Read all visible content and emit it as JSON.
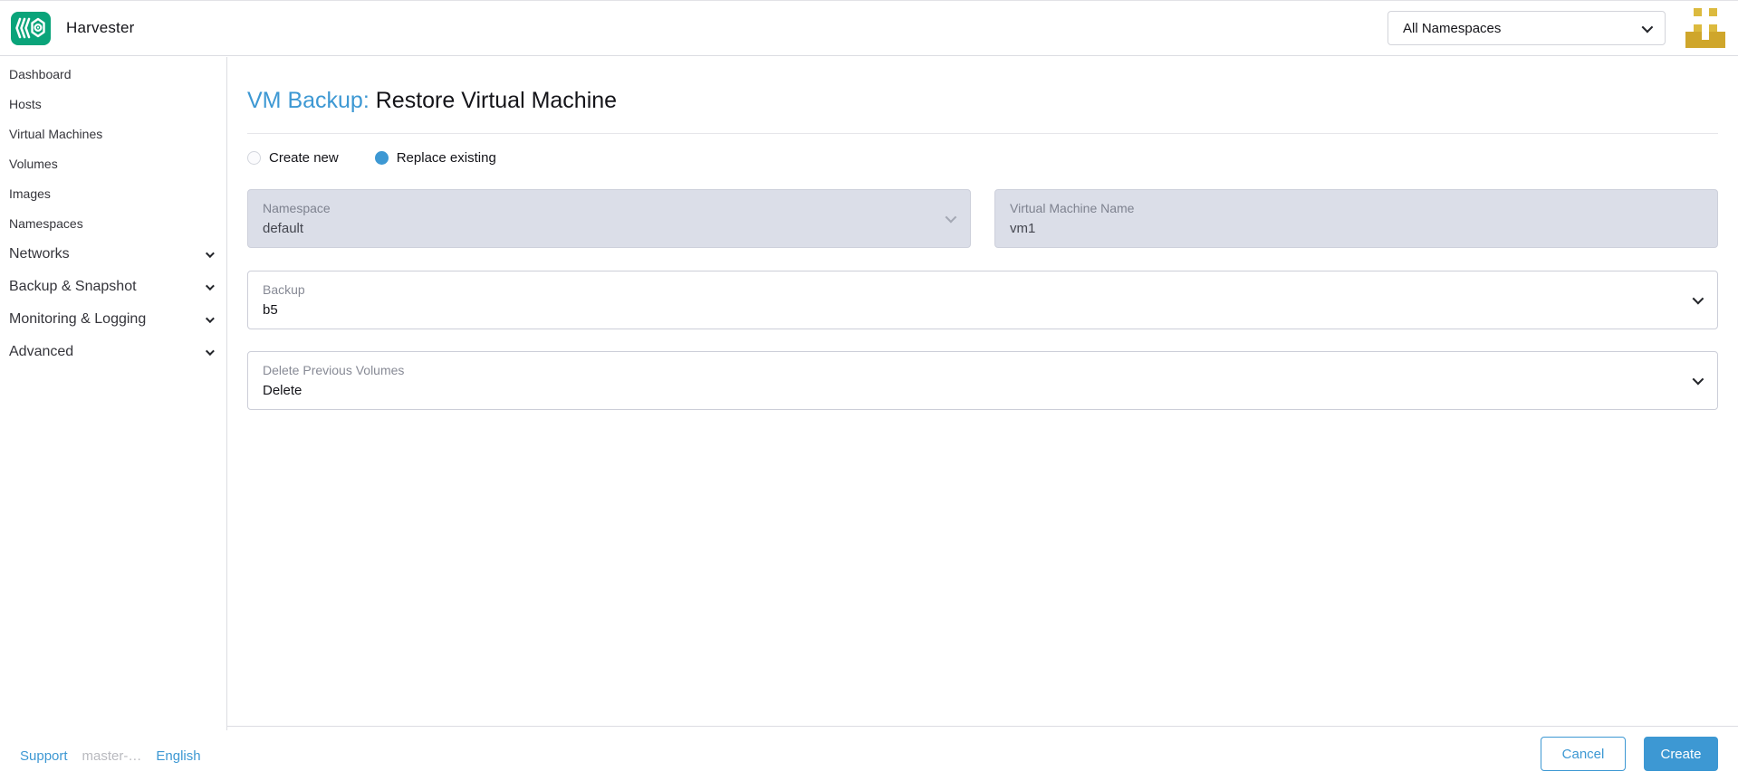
{
  "header": {
    "app_name": "Harvester",
    "namespace_filter": "All Namespaces",
    "avatar": {
      "pattern": [
        "01010",
        "00000",
        "01010",
        "11011",
        "11111"
      ],
      "color_light": "#dcba3e",
      "color_dark": "#cfa62b"
    }
  },
  "sidebar": {
    "items": [
      {
        "label": "Dashboard"
      },
      {
        "label": "Hosts"
      },
      {
        "label": "Virtual Machines"
      },
      {
        "label": "Volumes"
      },
      {
        "label": "Images"
      },
      {
        "label": "Namespaces"
      }
    ],
    "groups": [
      {
        "label": "Networks"
      },
      {
        "label": "Backup & Snapshot"
      },
      {
        "label": "Monitoring & Logging"
      },
      {
        "label": "Advanced"
      }
    ],
    "footer": {
      "support": "Support",
      "version": "master-…",
      "language": "English"
    }
  },
  "main": {
    "title_prefix": "VM Backup:",
    "title": "Restore Virtual Machine",
    "radios": [
      {
        "label": "Create new",
        "selected": false
      },
      {
        "label": "Replace existing",
        "selected": true
      }
    ],
    "fields": {
      "namespace": {
        "label": "Namespace",
        "value": "default"
      },
      "vm_name": {
        "label": "Virtual Machine Name",
        "value": "vm1"
      },
      "backup": {
        "label": "Backup",
        "value": "b5"
      },
      "delete_volumes": {
        "label": "Delete Previous Volumes",
        "value": "Delete"
      }
    },
    "actions": {
      "cancel": "Cancel",
      "create": "Create"
    }
  },
  "colors": {
    "accent_blue": "#3d98d3",
    "brand_green": "#0aa47a",
    "disabled_field_bg": "#dbdee8",
    "avatar_gold": "#cfa62b"
  }
}
